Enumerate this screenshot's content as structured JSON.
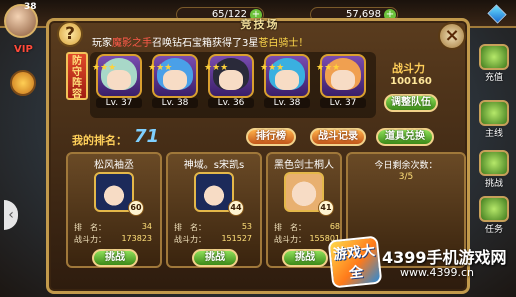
{
  "hud": {
    "player_level": "38",
    "vip": "VIP",
    "stamina": "65/122",
    "gold": "57,698",
    "add": "+"
  },
  "side_menu": [
    {
      "label": "充值",
      "icon": "recharge-icon"
    },
    {
      "label": "主线",
      "icon": "mainline-icon"
    },
    {
      "label": "挑战",
      "icon": "challenge-icon"
    },
    {
      "label": "任务",
      "icon": "task-icon"
    }
  ],
  "arena": {
    "title": "竞技场",
    "help": "?",
    "close": "×",
    "notice": {
      "prefix": "玩家",
      "player": "魔影之手",
      "middle": "召唤钻石宝箱获得了3星",
      "reward": "苍白骑士！"
    },
    "defense_label": "防守阵容",
    "team": [
      {
        "level": "Lv. 37",
        "hair": "#a8d8c8",
        "stars": "★★★"
      },
      {
        "level": "Lv. 38",
        "hair": "#4aa0e8",
        "stars": "★★★"
      },
      {
        "level": "Lv. 36",
        "hair": "#2a2a3a",
        "stars": "★★★"
      },
      {
        "level": "Lv. 38",
        "hair": "#3ab0e0",
        "stars": "★★★"
      },
      {
        "level": "Lv. 37",
        "hair": "#f0a050",
        "stars": "★★★"
      }
    ],
    "power_label": "战斗力",
    "power_value": "100160",
    "adjust_team": "调整队伍",
    "my_rank_label": "我的排名：",
    "my_rank_value": "71",
    "leaderboard": "排行榜",
    "battle_log": "战斗记录",
    "shop": "道具兑换",
    "opponents": [
      {
        "name": "松风袖丞",
        "rank_label": "排　名：",
        "rank": "34",
        "power_label": "战斗力：",
        "power": "173823",
        "badge": "60",
        "button": "挑战"
      },
      {
        "name": "神域。s宋凯s",
        "rank_label": "排　名：",
        "rank": "53",
        "power_label": "战斗力：",
        "power": "151527",
        "badge": "44",
        "button": "挑战"
      },
      {
        "name": "黑色剑士桐人",
        "rank_label": "排　名：",
        "rank": "68",
        "power_label": "战斗力：",
        "power": "155801",
        "badge": "41",
        "button": "挑战"
      }
    ],
    "remaining_label": "今日剩余次数：",
    "remaining_value": "3/5"
  },
  "watermark": {
    "logo": "游戏大全",
    "text": "4399手机游戏网",
    "url": "www.4399.cn"
  }
}
